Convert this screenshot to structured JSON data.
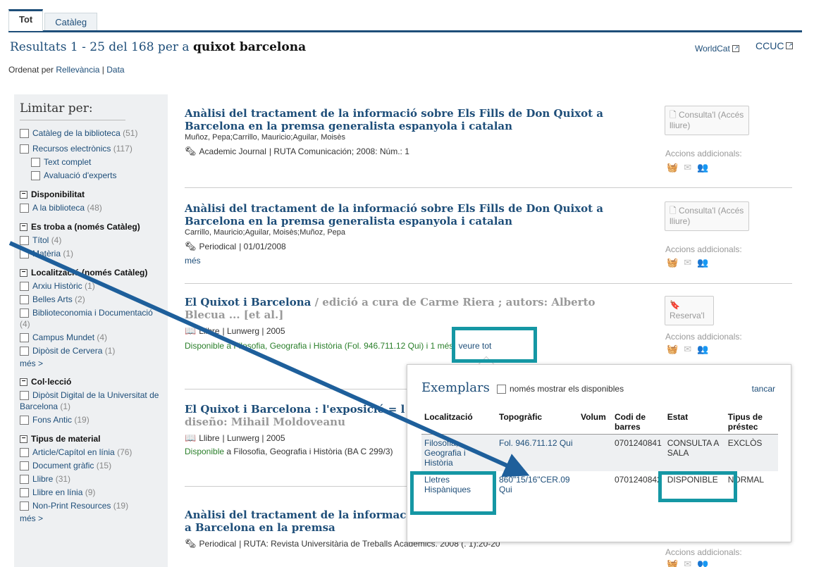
{
  "tabs": [
    {
      "label": "Tot"
    },
    {
      "label": "Catàleg"
    }
  ],
  "results": {
    "prefix": "Resultats 1 - 25 del 168 per a",
    "query": "quixot barcelona"
  },
  "external": {
    "worldcat": "WorldCat",
    "ccuc": "CCUC"
  },
  "sort": {
    "label": "Ordenat per",
    "relevance": "Rellevància",
    "sep": " | ",
    "date": "Data"
  },
  "sidebar": {
    "title": "Limitar per:",
    "top_items": [
      {
        "label": "Catàleg de la biblioteca",
        "count": "(51)"
      },
      {
        "label": "Recursos electrònics",
        "count": "(117)"
      }
    ],
    "sub_items": [
      {
        "label": "Text complet"
      },
      {
        "label": "Avaluació d'experts"
      }
    ],
    "facets": [
      {
        "head": "Disponibilitat",
        "items": [
          {
            "label": "A la biblioteca",
            "count": "(48)"
          }
        ]
      },
      {
        "head": "Es troba a (només Catàleg)",
        "items": [
          {
            "label": "Títol",
            "count": "(4)"
          },
          {
            "label": "Matèria",
            "count": "(1)"
          }
        ]
      },
      {
        "head": "Localització (només Catàleg)",
        "items": [
          {
            "label": "Arxiu Històric",
            "count": "(1)"
          },
          {
            "label": "Belles Arts",
            "count": "(2)"
          },
          {
            "label": "Biblioteconomia i Documentació",
            "count": "(4)"
          },
          {
            "label": "Campus Mundet",
            "count": "(4)"
          },
          {
            "label": "Dipòsit de Cervera",
            "count": "(1)"
          }
        ],
        "more": "més >"
      },
      {
        "head": "Col·lecció",
        "items": [
          {
            "label": "Dipòsit Digital de la Universitat de Barcelona",
            "count": "(1)"
          },
          {
            "label": "Fons Antic",
            "count": "(19)"
          }
        ]
      },
      {
        "head": "Tipus de material",
        "items": [
          {
            "label": "Article/Capítol en línia",
            "count": "(76)"
          },
          {
            "label": "Document gràfic",
            "count": "(15)"
          },
          {
            "label": "Llibre",
            "count": "(31)"
          },
          {
            "label": "Llibre en línia",
            "count": "(9)"
          },
          {
            "label": "Non-Print Resources",
            "count": "(19)"
          }
        ],
        "more": "més >"
      }
    ]
  },
  "items": [
    {
      "title": "Anàlisi del tractament de la informació sobre Els Fills de Don Quixot a Barcelona en la premsa generalista espanyola i catalan",
      "authors": "Muñoz, Pepa;Carrillo, Mauricio;Aguilar, Moisès",
      "type": "Academic Journal",
      "meta": " | RUTA Comunicación; 2008: Núm.: 1",
      "action": "Consulta'l (Accés lliure)"
    },
    {
      "title": "Anàlisi del tractament de la informació sobre Els Fills de Don Quixot a Barcelona en la premsa generalista espanyola i catalan",
      "authors": "Carrillo, Mauricio;Aguilar, Moisès;Muñoz, Pepa",
      "type": "Periodical",
      "meta": " | 01/01/2008",
      "more": "més",
      "action": "Consulta'l (Accés lliure)"
    },
    {
      "title": "El Quixot i Barcelona",
      "resp": " / edició a cura de Carme Riera ; autors: Alberto Blecua ... [et al.]",
      "type": "Llibre",
      "meta": " | Lunwerg | 2005",
      "avail": "Disponible a Filosofia, Geografia i Història (Fol. 946.711.12 Qui) i 1 més",
      "see_all": "veure tot",
      "action": "Reserva'l"
    },
    {
      "title": "El Quixot i Barcelona : l'exposició = l",
      "resp_line": "diseño: Mihail Moldoveanu",
      "type": "Llibre",
      "meta": " | Lunwerg | 2005",
      "avail_pre": "Disponible",
      "avail": " a Filosofia, Geografia i Història (BA C 299/3)"
    },
    {
      "title": "Anàlisi del tractament de la informac",
      "title2": "a Barcelona en la premsa",
      "type": "Periodical",
      "meta": " | RUTA: Revista Universitària de Treballs Acadèmics. 2008 (. 1):20-20"
    }
  ],
  "additional_actions": "Accions addicionals:",
  "popup": {
    "title": "Exemplars",
    "only_available": "només mostrar els disponibles",
    "close": "tancar",
    "headers": [
      "Localització",
      "Topogràfic",
      "Volum",
      "Codi de barres",
      "Estat",
      "Tipus de préstec"
    ],
    "rows": [
      [
        "Filosofia, Geografia i Història",
        "Fol. 946.711.12 Qui",
        "",
        "0701240841",
        "CONSULTA A SALA",
        "EXCLÒS"
      ],
      [
        "Lletres Hispàniques",
        "860\"15/16\"CER.09 Qui",
        "",
        "0701240842",
        "DISPONIBLE",
        "NORMAL"
      ]
    ]
  },
  "colors": {
    "accent": "#1e4e79",
    "highlight": "#1597a4",
    "available": "#2a7f2a"
  }
}
